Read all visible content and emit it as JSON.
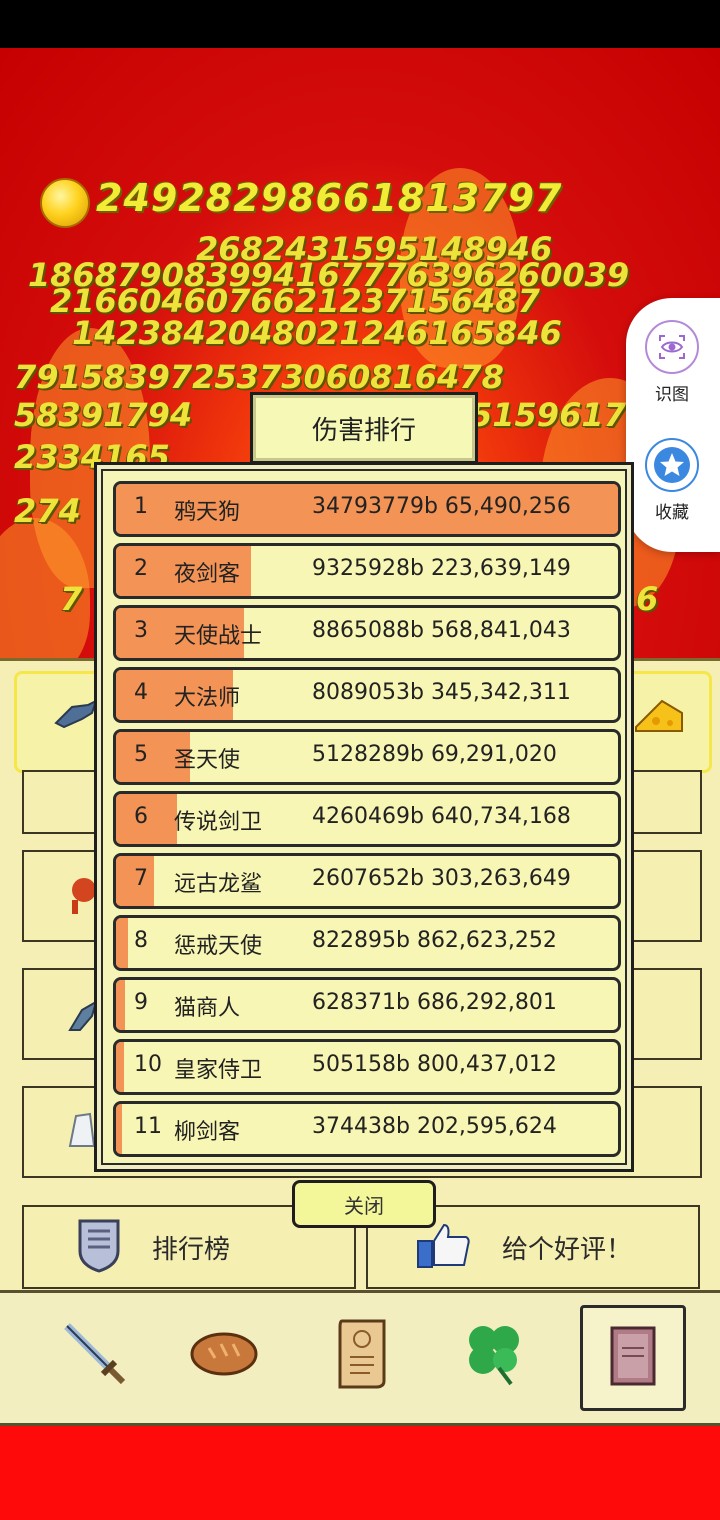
{
  "hud": {
    "gold": "24928298661813797"
  },
  "floating_numbers": [
    "2682431595148946",
    "186879083994167776396260039",
    "2166046076621237156487",
    "1423842048021246165846",
    "7915839725373060816478",
    "58391794",
    "5159617",
    "2334165",
    "274",
    "7",
    "6"
  ],
  "side_panel": {
    "recognize_label": "识图",
    "favorite_label": "收藏"
  },
  "modal": {
    "title": "伤害排行",
    "close_label": "关闭",
    "rows": [
      {
        "rank": "1",
        "name": "鸦天狗",
        "score": "34793779b 65,490,256",
        "fill": 1.0
      },
      {
        "rank": "2",
        "name": "夜剑客",
        "score": "9325928b 223,639,149",
        "fill": 0.268
      },
      {
        "rank": "3",
        "name": "天使战士",
        "score": "8865088b 568,841,043",
        "fill": 0.255
      },
      {
        "rank": "4",
        "name": "大法师",
        "score": "8089053b 345,342,311",
        "fill": 0.233
      },
      {
        "rank": "5",
        "name": "圣天使",
        "score": "5128289b 69,291,020",
        "fill": 0.147
      },
      {
        "rank": "6",
        "name": "传说剑卫",
        "score": "4260469b 640,734,168",
        "fill": 0.122
      },
      {
        "rank": "7",
        "name": "远古龙鲨",
        "score": "2607652b 303,263,649",
        "fill": 0.075
      },
      {
        "rank": "8",
        "name": "惩戒天使",
        "score": "822895b 862,623,252",
        "fill": 0.024
      },
      {
        "rank": "9",
        "name": "猫商人",
        "score": "628371b 686,292,801",
        "fill": 0.018
      },
      {
        "rank": "10",
        "name": "皇家侍卫",
        "score": "505158b 800,437,012",
        "fill": 0.015
      },
      {
        "rank": "11",
        "name": "柳剑客",
        "score": "374438b 202,595,624",
        "fill": 0.011
      }
    ]
  },
  "bottom_buttons": {
    "leaderboard_label": "排行榜",
    "review_label": "给个好评！"
  },
  "colors": {
    "rank_fill": "#f39456",
    "panel_bg": "#f5eeb5",
    "sky_red": "#c60000",
    "number_yellow": "#eee33a"
  }
}
